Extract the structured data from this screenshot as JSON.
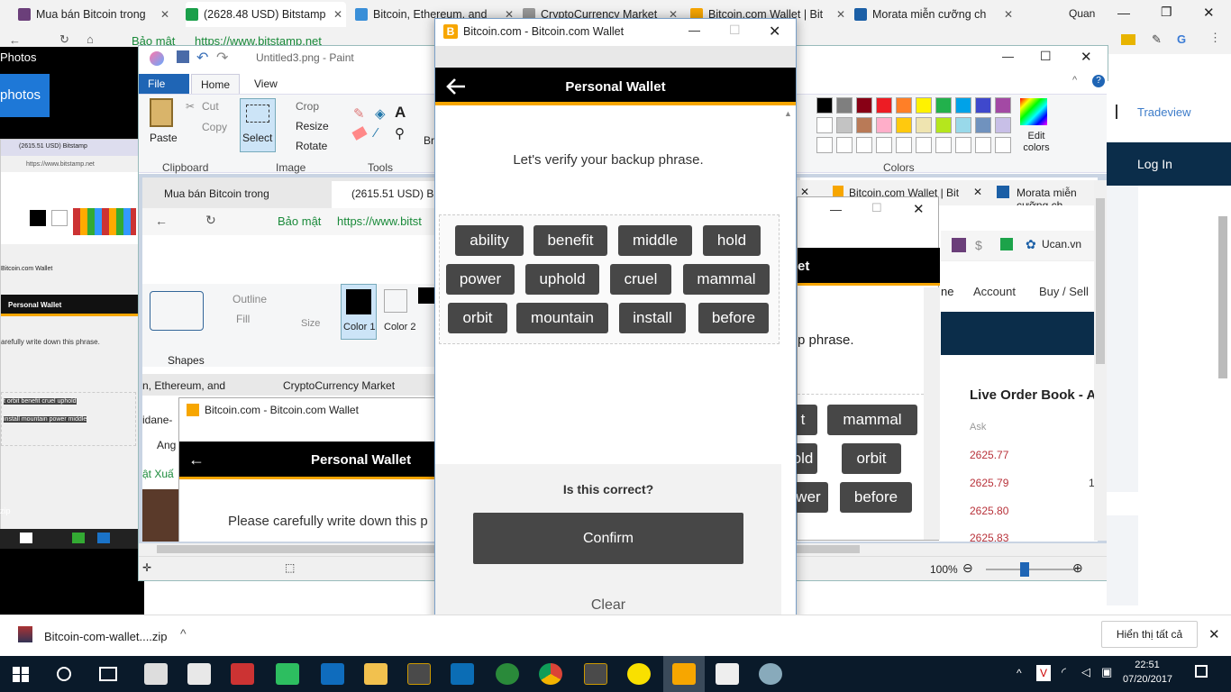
{
  "chrome_tabs": [
    {
      "label": "Mua bán Bitcoin trong",
      "color": "#6b3f7a"
    },
    {
      "label": "(2628.48 USD) Bitstamp",
      "color": "#1a9f4a"
    },
    {
      "label": "Bitcoin, Ethereum, and",
      "color": "#3a8fd8"
    },
    {
      "label": "CryptoCurrency Market",
      "color": "#999999"
    },
    {
      "label": "Bitcoin.com Wallet | Bit",
      "color": "#f7a600"
    },
    {
      "label": "Morata miễn cưỡng ch",
      "color": "#1b5fa6"
    }
  ],
  "chrome_user": "Quan",
  "address_bar": {
    "secure_label": "Bảo mật",
    "url": "https://www.bitstamp.net"
  },
  "photos": {
    "title": "Photos",
    "button": "photos"
  },
  "paint": {
    "title": "Untitled3.png - Paint",
    "tabs": [
      "File",
      "Home",
      "View"
    ],
    "clipboard": {
      "paste": "Paste",
      "cut": "Cut",
      "copy": "Copy",
      "label": "Clipboard"
    },
    "image": {
      "select": "Select",
      "crop": "Crop",
      "resize": "Resize",
      "rotate": "Rotate",
      "label": "Image"
    },
    "tools_label": "Tools",
    "brushes_label": "Bru",
    "colors_label": "Colors",
    "edit_colors": "Edit colors",
    "shapes": {
      "outline": "Outline",
      "fill": "Fill",
      "label": "Shapes",
      "size": "Size",
      "color1": "Color 1",
      "color2": "Color 2"
    },
    "zoom": "100%",
    "inner": {
      "tab1": "Mua bán Bitcoin trong",
      "tab2": "(2615.51 USD) Bits",
      "tab3": "Bitcoin.com Wallet | Bit",
      "tab4": "Morata miễn cu",
      "secure": "Bảo mật",
      "url": "https://www.bitst",
      "tab5": "n, Ethereum, and",
      "tab6": "CryptoCurrency Market",
      "side1": "idane-",
      "side2": "Ang",
      "side3": "ật Xuấ",
      "wallet_title": "Bitcoin.com - Bitcoin.com Wallet",
      "personal": "Personal Wallet",
      "write_down": "Please carefully write down this p"
    }
  },
  "bitstamp": {
    "tradeview": "Tradeview",
    "login": "Log In",
    "nav": [
      "Account",
      "Buy / Sell"
    ],
    "nav_prefix": "ne",
    "bookmark": "Ucan.vn",
    "order_book": "Live Order Book - A",
    "ask": "Ask",
    "prices": [
      "2625.77",
      "2625.79",
      "2625.80",
      "2625.83"
    ],
    "side_digit": "1",
    "phrase_tail": "p phrase.",
    "wallet_header_tail": "et",
    "bg_words": [
      "t",
      "mammal",
      "old",
      "orbit",
      "wer",
      "before"
    ]
  },
  "wallet": {
    "window_title": "Bitcoin.com - Bitcoin.com Wallet",
    "header": "Personal Wallet",
    "instruction": "Let's verify your backup phrase.",
    "words": [
      "ability",
      "benefit",
      "middle",
      "hold",
      "power",
      "uphold",
      "cruel",
      "mammal",
      "orbit",
      "mountain",
      "install",
      "before"
    ],
    "question": "Is this correct?",
    "confirm": "Confirm",
    "clear": "Clear"
  },
  "thumb": {
    "tab1": "(2615.51 USD) Bitstamp",
    "url": "https://www.bitstamp.net",
    "personal": "Personal Wallet",
    "write": "arefully write down this phrase.",
    "wallet": "Bitcoin.com Wallet",
    "words1": "t orbit benefit cruel uphold",
    "words2": "install mountain power middle"
  },
  "downloads": {
    "file": "Bitcoin-com-wallet....zip",
    "show_all": "Hiển thị tất cả"
  },
  "taskbar": {
    "time": "22:51",
    "date": "07/20/2017"
  }
}
